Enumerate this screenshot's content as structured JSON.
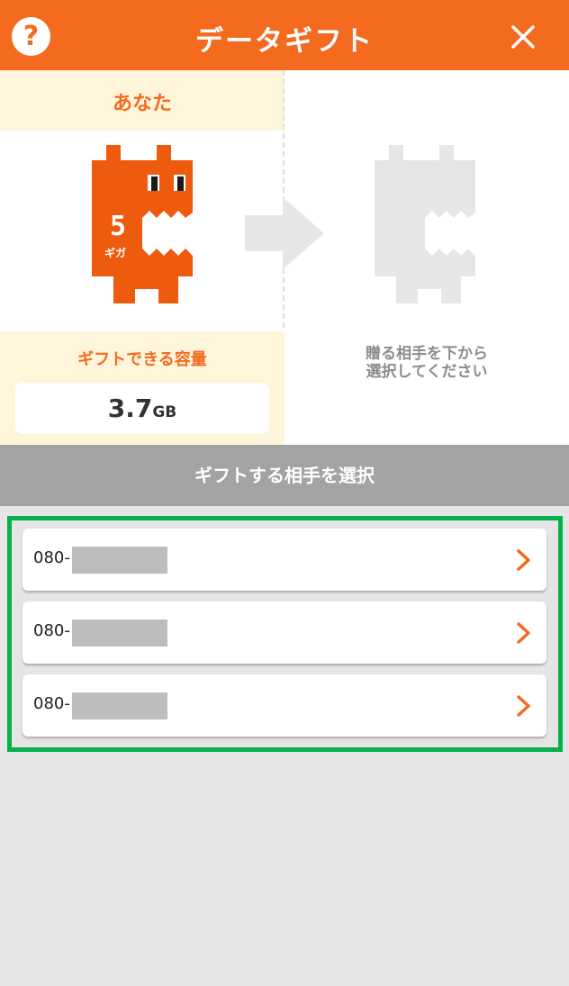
{
  "header": {
    "title": "データギフト",
    "help_symbol": "?",
    "colors": {
      "brand": "#f46a1f"
    }
  },
  "panel": {
    "you_label": "あなた",
    "character_badge": {
      "number": "5",
      "text": "ギガ"
    },
    "capacity_label": "ギフトできる容量",
    "capacity_value": "3.7",
    "capacity_unit": "GB",
    "recipient_hint_line1": "贈る相手を下から",
    "recipient_hint_line2": "選択してください"
  },
  "section": {
    "title": "ギフトする相手を選択"
  },
  "recipients": [
    {
      "prefix": "080-"
    },
    {
      "prefix": "080-"
    },
    {
      "prefix": "080-"
    }
  ],
  "highlight_color": "#06b04b"
}
